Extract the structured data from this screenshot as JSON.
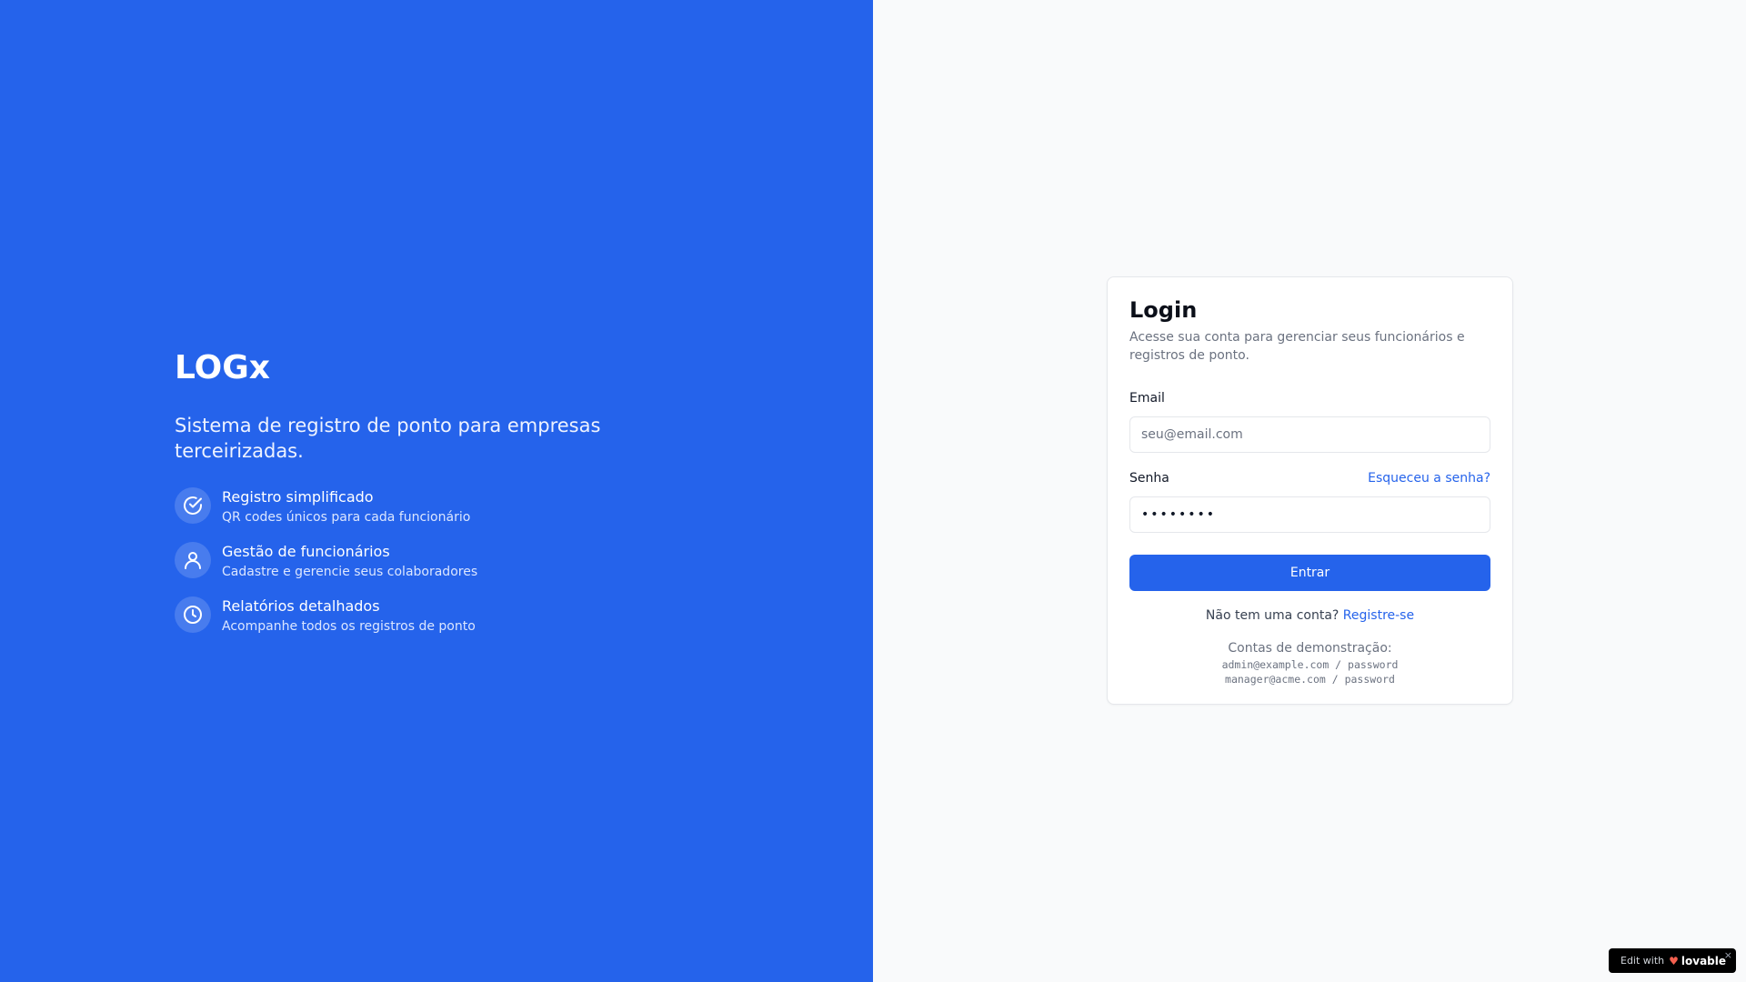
{
  "brand": {
    "name": "LOGx",
    "tagline": "Sistema de registro de ponto para empresas terceirizadas."
  },
  "features": [
    {
      "icon": "check-circle-icon",
      "title": "Registro simplificado",
      "description": "QR codes únicos para cada funcionário"
    },
    {
      "icon": "user-icon",
      "title": "Gestão de funcionários",
      "description": "Cadastre e gerencie seus colaboradores"
    },
    {
      "icon": "clock-icon",
      "title": "Relatórios detalhados",
      "description": "Acompanhe todos os registros de ponto"
    }
  ],
  "login": {
    "title": "Login",
    "subtitle": "Acesse sua conta para gerenciar seus funcionários e registros de ponto.",
    "email_label": "Email",
    "email_placeholder": "seu@email.com",
    "email_value": "",
    "password_label": "Senha",
    "password_value": "password",
    "forgot_label": "Esqueceu a senha?",
    "submit_label": "Entrar",
    "register_prompt": "Não tem uma conta?",
    "register_link": "Registre-se",
    "demo_title": "Contas de demonstração:",
    "demo_accounts": [
      "admin@example.com / password",
      "manager@acme.com / password"
    ]
  },
  "badge": {
    "prefix": "Edit with",
    "brand": "lovable",
    "close": "×"
  },
  "colors": {
    "primary": "#2563eb",
    "page_bg": "#f9fafb",
    "muted_text": "#6b7280"
  }
}
